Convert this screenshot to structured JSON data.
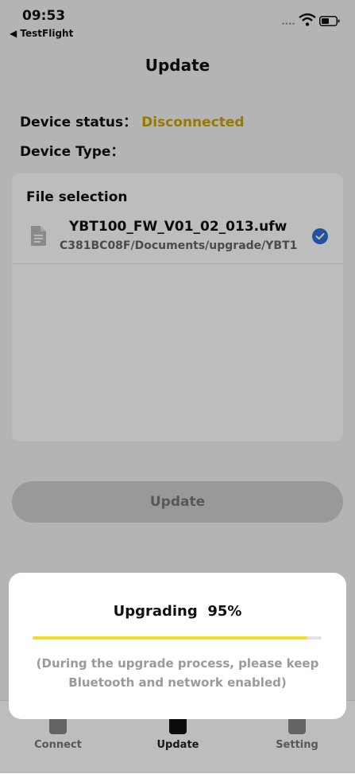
{
  "status_bar": {
    "time": "09:53",
    "back_label": "◀ TestFlight"
  },
  "header": {
    "title": "Update"
  },
  "device": {
    "status_label": "Device status：",
    "status_value": "Disconnected",
    "status_color": "#caa400",
    "type_label": "Device Type："
  },
  "file_selection": {
    "heading": "File selection",
    "files": [
      {
        "name": "YBT100_FW_V01_02_013.ufw",
        "path": "C381BC08F/Documents/upgrade/YBT1",
        "selected": true
      }
    ]
  },
  "update_button": {
    "label": "Update"
  },
  "tabs": [
    {
      "label": "Connect",
      "icon": "link-icon",
      "active": false
    },
    {
      "label": "Update",
      "icon": "upload-icon",
      "active": true
    },
    {
      "label": "Setting",
      "icon": "gear-icon",
      "active": false
    }
  ],
  "dialog": {
    "title": "Upgrading",
    "percent_text": "95%",
    "progress": 0.95,
    "hint": "(During the upgrade process, please keep Bluetooth and network enabled)"
  }
}
